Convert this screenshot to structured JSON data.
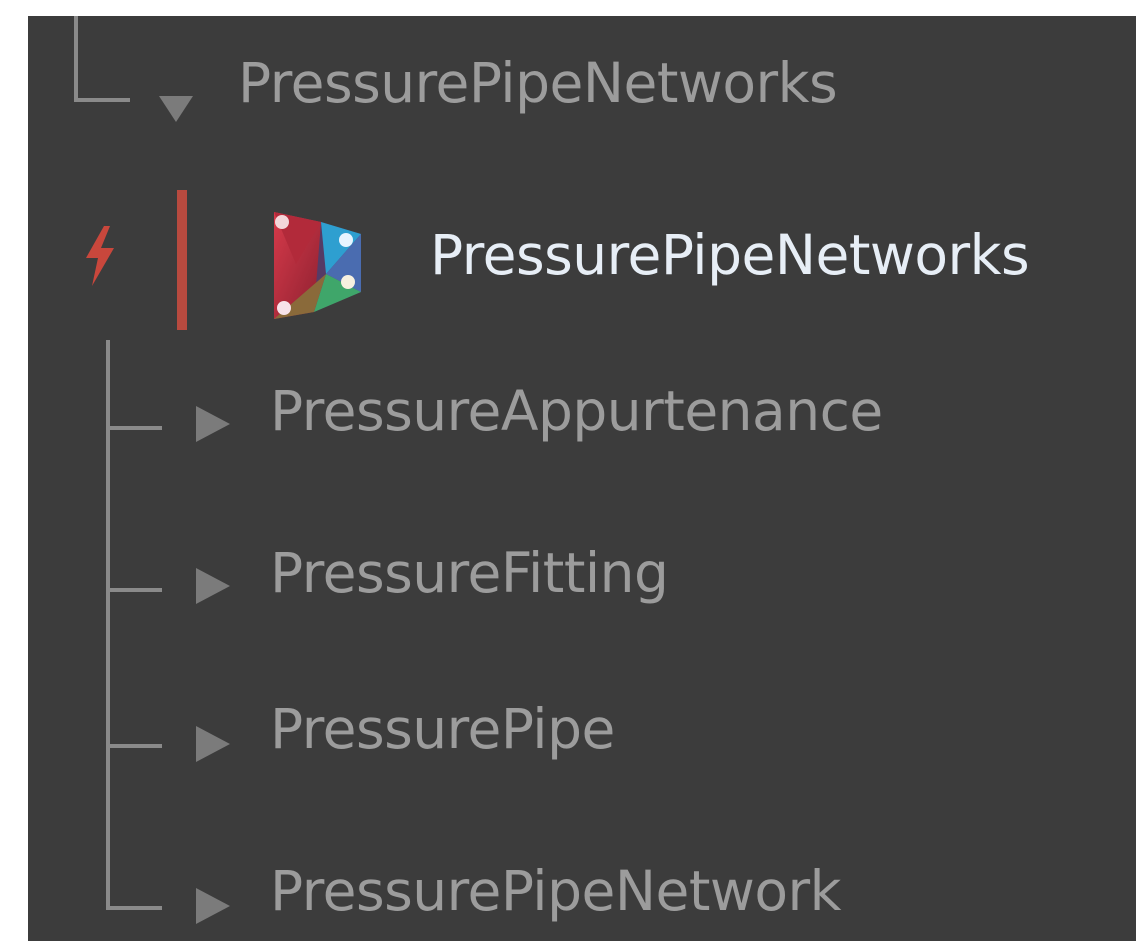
{
  "tree": {
    "parent": {
      "label": "PressurePipeNetworks",
      "expanded": true
    },
    "active_node": {
      "label": "PressurePipeNetworks",
      "icon": "dynamo-package-icon",
      "status_icon": "lightning-bolt-icon"
    },
    "children": [
      {
        "label": "PressureAppurtenance",
        "expanded": false
      },
      {
        "label": "PressureFitting",
        "expanded": false
      },
      {
        "label": "PressurePipe",
        "expanded": false
      },
      {
        "label": "PressurePipeNetwork",
        "expanded": false
      }
    ]
  },
  "colors": {
    "panel_background": "#3c3c3c",
    "text_dim": "#9c9c9c",
    "text_bright": "#e7eef6",
    "active_accent": "#b84a3f",
    "tree_line": "#8a8a8a"
  }
}
